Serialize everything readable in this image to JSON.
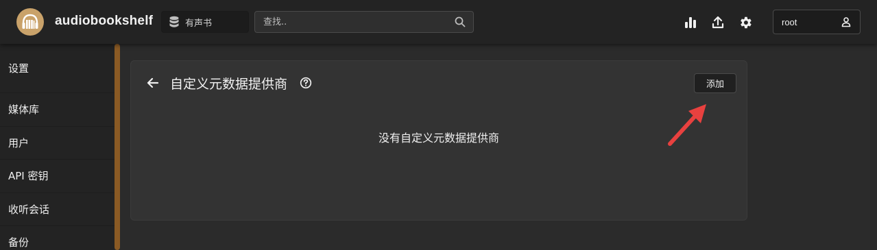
{
  "header": {
    "brand": "audiobookshelf",
    "library": "有声书",
    "search_placeholder": "查找..",
    "user": "root"
  },
  "sidebar": {
    "items": [
      {
        "label": "设置"
      },
      {
        "label": "媒体库"
      },
      {
        "label": "用户"
      },
      {
        "label": "API 密钥"
      },
      {
        "label": "收听会话"
      },
      {
        "label": "备份"
      }
    ]
  },
  "main": {
    "title": "自定义元数据提供商",
    "add_label": "添加",
    "empty_message": "没有自定义元数据提供商"
  },
  "colors": {
    "accent": "#8a5a24",
    "annotation": "#e8413f"
  }
}
